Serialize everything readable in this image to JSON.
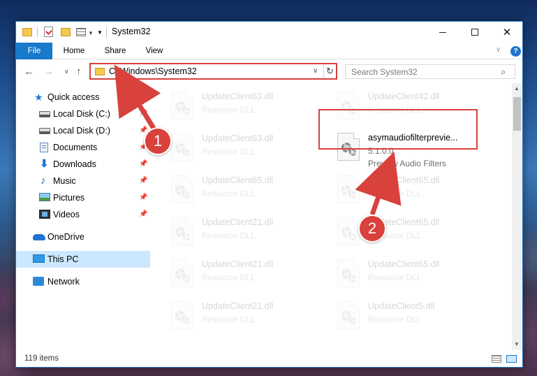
{
  "window": {
    "title": "System32",
    "controls": {
      "minimize_icon": "minimize-icon",
      "maximize_icon": "maximize-icon",
      "close_icon": "close-icon"
    }
  },
  "ribbon": {
    "tabs": [
      "File",
      "Home",
      "Share",
      "View"
    ],
    "help_label": "?"
  },
  "address": {
    "path": "C:\\Windows\\System32",
    "search_placeholder": "Search System32"
  },
  "sidebar": {
    "items": [
      {
        "label": "Quick access",
        "icon": "star-icon",
        "pinned": false
      },
      {
        "label": "Local Disk (C:)",
        "icon": "drive-icon",
        "pinned": true
      },
      {
        "label": "Local Disk (D:)",
        "icon": "drive-icon",
        "pinned": true
      },
      {
        "label": "Documents",
        "icon": "documents-icon",
        "pinned": true
      },
      {
        "label": "Downloads",
        "icon": "downloads-icon",
        "pinned": true
      },
      {
        "label": "Music",
        "icon": "music-icon",
        "pinned": true
      },
      {
        "label": "Pictures",
        "icon": "pictures-icon",
        "pinned": true
      },
      {
        "label": "Videos",
        "icon": "videos-icon",
        "pinned": true
      },
      {
        "label": "OneDrive",
        "icon": "onedrive-icon",
        "pinned": false
      },
      {
        "label": "This PC",
        "icon": "this-pc-icon",
        "pinned": false,
        "selected": true
      },
      {
        "label": "Network",
        "icon": "network-icon",
        "pinned": false
      }
    ]
  },
  "files": {
    "left_column": [
      {
        "name": "UpdateClient63.dll",
        "type": "Resource DLL"
      },
      {
        "name": "UpdateClient63.dll",
        "type": "Resource DLL"
      },
      {
        "name": "UpdateClient65.dll",
        "type": "Resource DLL"
      },
      {
        "name": "UpdateClient21.dll",
        "type": "Resource DLL"
      },
      {
        "name": "UpdateClient21.dll",
        "type": "Resource DLL"
      },
      {
        "name": "UpdateClient21.dll",
        "type": "Resource DLL"
      }
    ],
    "right_column": [
      {
        "name": "UpdateClient42.dll",
        "type": "Resource DLL"
      },
      {
        "name": "UpdateClient65.dll",
        "type": "Resource DLL"
      },
      {
        "name": "UpdateClient65.dll",
        "type": "Resource DLL"
      },
      {
        "name": "UpdateClient65.dll",
        "type": "Resource DLL"
      },
      {
        "name": "UpdateClient5.dll",
        "type": "Resource DLL"
      }
    ],
    "highlighted": {
      "name": "asymaudiofilterprevie...",
      "version": "5.1.0.0",
      "description": "Preview Audio Filters"
    }
  },
  "status": {
    "item_count": "119 items"
  },
  "annotations": {
    "badge_1": "1",
    "badge_2": "2",
    "color": "#d9413c"
  }
}
